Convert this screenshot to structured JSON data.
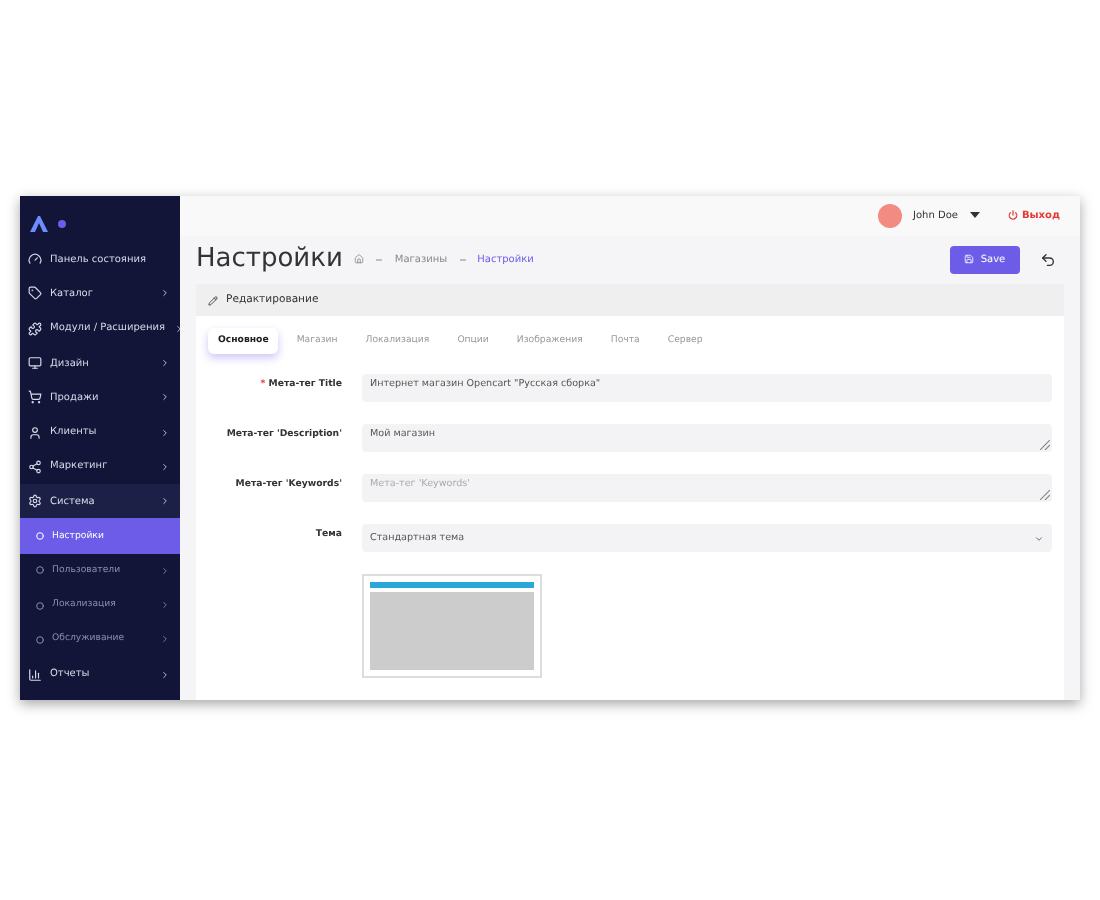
{
  "sidebar": {
    "items": [
      {
        "label": "Панель состояния",
        "has_arrow": false,
        "selected": false
      },
      {
        "label": "Каталог",
        "has_arrow": true,
        "selected": false
      },
      {
        "label": "Модули / Расширения",
        "has_arrow": true,
        "selected": false
      },
      {
        "label": "Дизайн",
        "has_arrow": true,
        "selected": false
      },
      {
        "label": "Продажи",
        "has_arrow": true,
        "selected": false
      },
      {
        "label": "Клиенты",
        "has_arrow": true,
        "selected": false
      },
      {
        "label": "Маркетинг",
        "has_arrow": true,
        "selected": false
      },
      {
        "label": "Система",
        "has_arrow": true,
        "selected": false,
        "expanded": true,
        "children": [
          {
            "label": "Настройки",
            "has_arrow": false,
            "selected": true
          },
          {
            "label": "Пользователи",
            "has_arrow": true,
            "selected": false
          },
          {
            "label": "Локализация",
            "has_arrow": true,
            "selected": false
          },
          {
            "label": "Обслуживание",
            "has_arrow": true,
            "selected": false
          }
        ]
      },
      {
        "label": "Отчеты",
        "has_arrow": true,
        "selected": false
      }
    ]
  },
  "topbar": {
    "user": "John Doe",
    "logout": "Выход"
  },
  "page": {
    "title": "Настройки",
    "breadcrumb": [
      {
        "label": "Магазины",
        "current": false
      },
      {
        "label": "Настройки",
        "current": true
      }
    ],
    "save": "Save"
  },
  "card": {
    "title": "Редактирование",
    "tabs": [
      {
        "label": "Основное",
        "selected": true
      },
      {
        "label": "Магазин",
        "selected": false
      },
      {
        "label": "Локализация",
        "selected": false
      },
      {
        "label": "Опции",
        "selected": false
      },
      {
        "label": "Изображения",
        "selected": false
      },
      {
        "label": "Почта",
        "selected": false
      },
      {
        "label": "Сервер",
        "selected": false
      }
    ],
    "fields": [
      {
        "kind": "input",
        "label": "Мета-тег Title",
        "required_mark": "*",
        "value": "Интернет магазин Opencart \"Русская сборка\""
      },
      {
        "kind": "textarea",
        "label": "Мета-тег 'Description'",
        "value": "Мой магазин"
      },
      {
        "kind": "textarea",
        "label": "Мета-тег 'Keywords'",
        "placeholder": "Мета-тег 'Keywords'"
      },
      {
        "kind": "select",
        "label": "Тема",
        "value": "Стандартная тема"
      },
      {
        "kind": "preview"
      }
    ]
  }
}
